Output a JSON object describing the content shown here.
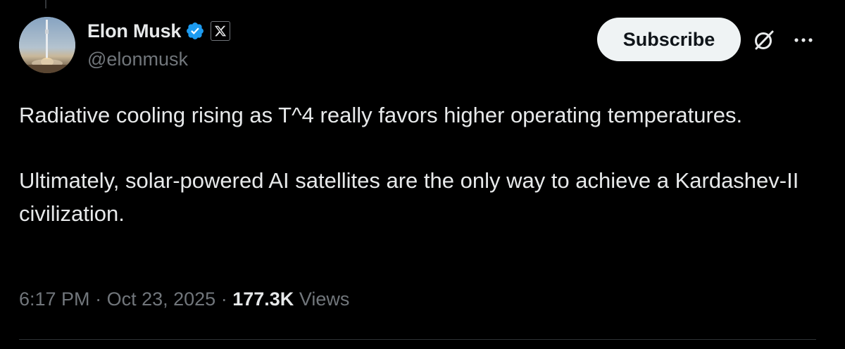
{
  "author": {
    "name": "Elon Musk",
    "handle": "@elonmusk",
    "verified": true,
    "affiliate_badge": "x-logo-icon"
  },
  "actions": {
    "subscribe_label": "Subscribe",
    "grok_icon": "grok-icon",
    "more_icon": "more-options-icon"
  },
  "tweet": {
    "paragraphs": [
      "Radiative cooling rising as T^4 really favors higher operating temperatures.",
      "Ultimately, solar-powered AI satellites are the only way to achieve a Kardashev-II civilization."
    ],
    "time": "6:17 PM",
    "separator": "·",
    "date": "Oct 23, 2025",
    "views_count": "177.3K",
    "views_label": "Views"
  },
  "colors": {
    "background": "#000000",
    "primary_text": "#e7e9ea",
    "secondary_text": "#71767b",
    "verified_blue": "#1d9bf0",
    "button_bg": "#eff3f4",
    "divider": "#2f3336"
  }
}
